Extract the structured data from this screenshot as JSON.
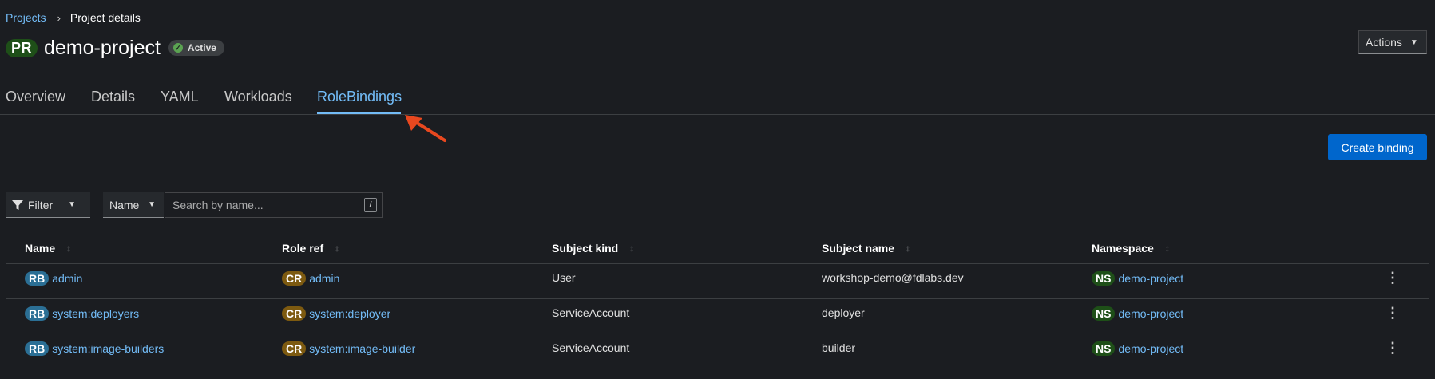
{
  "breadcrumb": {
    "parent": "Projects",
    "separator": "›",
    "current": "Project details"
  },
  "header": {
    "badge": "PR",
    "title": "demo-project",
    "status": "Active",
    "actions_label": "Actions"
  },
  "tabs": [
    {
      "label": "Overview"
    },
    {
      "label": "Details"
    },
    {
      "label": "YAML"
    },
    {
      "label": "Workloads"
    },
    {
      "label": "RoleBindings",
      "active": true
    }
  ],
  "toolbar": {
    "create_label": "Create binding",
    "filter_label": "Filter",
    "filter_attr_label": "Name",
    "search_placeholder": "Search by name...",
    "search_shortcut": "/"
  },
  "table": {
    "columns": [
      "Name",
      "Role ref",
      "Subject kind",
      "Subject name",
      "Namespace"
    ],
    "rows": [
      {
        "name_badge": "RB",
        "name": "admin",
        "role_badge": "CR",
        "role": "admin",
        "subject_kind": "User",
        "subject_name": "workshop-demo@fdlabs.dev",
        "ns_badge": "NS",
        "namespace": "demo-project"
      },
      {
        "name_badge": "RB",
        "name": "system:deployers",
        "role_badge": "CR",
        "role": "system:deployer",
        "subject_kind": "ServiceAccount",
        "subject_name": "deployer",
        "ns_badge": "NS",
        "namespace": "demo-project"
      },
      {
        "name_badge": "RB",
        "name": "system:image-builders",
        "role_badge": "CR",
        "role": "system:image-builder",
        "subject_kind": "ServiceAccount",
        "subject_name": "builder",
        "ns_badge": "NS",
        "namespace": "demo-project"
      }
    ]
  },
  "colors": {
    "accent": "#73bcf7",
    "primary_button": "#0066cc",
    "annotation_arrow": "#e8481f",
    "status_ok": "#5ba352"
  },
  "icons": {
    "status": "check-circle-icon",
    "filter": "funnel-icon",
    "sort": "sort-arrows-icon",
    "row_menu": "kebab-icon",
    "annotation": "arrow-icon"
  }
}
